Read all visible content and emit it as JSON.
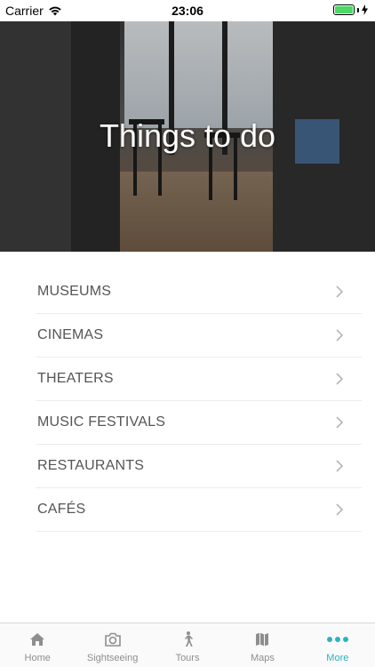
{
  "status_bar": {
    "carrier": "Carrier",
    "time": "23:06",
    "battery_level": 1.0,
    "battery_color": "#4cd964"
  },
  "hero": {
    "title": "Things to do"
  },
  "menu": {
    "items": [
      {
        "label": "MUSEUMS"
      },
      {
        "label": "CINEMAS"
      },
      {
        "label": "THEATERS"
      },
      {
        "label": "MUSIC FESTIVALS"
      },
      {
        "label": "RESTAURANTS"
      },
      {
        "label": "CAFÉS"
      }
    ],
    "chevron_icon": "chevron-right-icon"
  },
  "tab_bar": {
    "active_color": "#2bb3bf",
    "inactive_color": "#8e8e8e",
    "tabs": [
      {
        "label": "Home",
        "icon": "home-icon"
      },
      {
        "label": "Sightseeing",
        "icon": "camera-icon"
      },
      {
        "label": "Tours",
        "icon": "walking-person-icon"
      },
      {
        "label": "Maps",
        "icon": "map-icon"
      },
      {
        "label": "More",
        "icon": "more-dots-icon",
        "active": true
      }
    ]
  }
}
